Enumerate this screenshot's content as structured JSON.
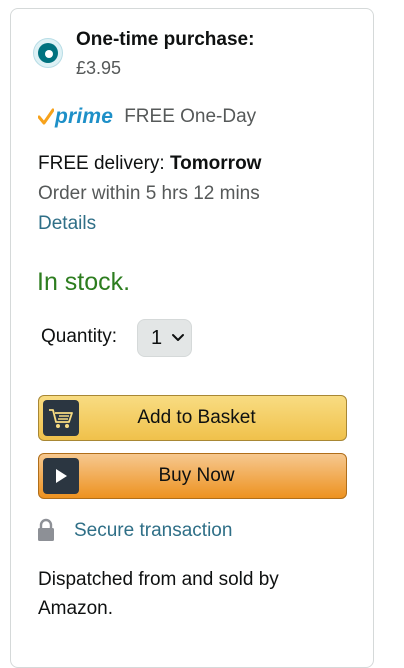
{
  "purchase_option": {
    "title": "One-time purchase:",
    "price": "£3.95",
    "selected": true
  },
  "prime": {
    "logo_text": "prime",
    "label": "FREE One-Day"
  },
  "delivery": {
    "prefix": "FREE delivery: ",
    "date": "Tomorrow",
    "order_within": "Order within 5 hrs 12 mins",
    "details_link": "Details"
  },
  "stock": {
    "status": "In stock.",
    "color": "#2d7d1f"
  },
  "quantity": {
    "label": "Quantity:",
    "value": "1"
  },
  "buttons": {
    "add_to_basket": "Add to Basket",
    "buy_now": "Buy Now"
  },
  "secure": {
    "label": "Secure transaction",
    "icon": "lock-icon"
  },
  "seller": {
    "text": "Dispatched from and sold by Amazon."
  },
  "colors": {
    "link": "#2f6f87",
    "prime_blue": "#1e90c8",
    "prime_check": "#f7a21b",
    "basket_button": "#f0c14b",
    "buy_button": "#ed9220",
    "radio_selected": "#00727f"
  }
}
